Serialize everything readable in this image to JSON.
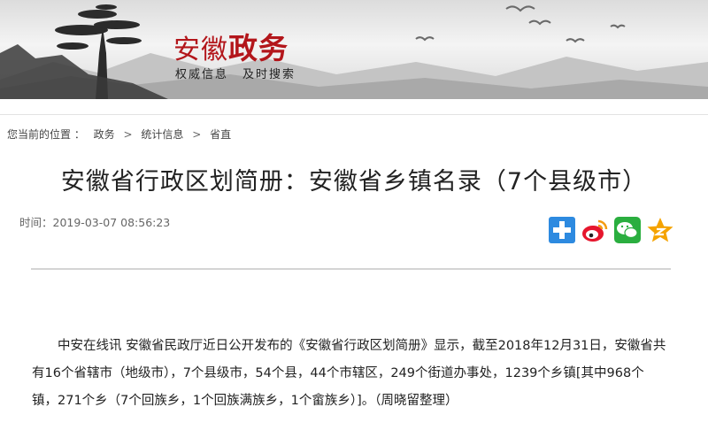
{
  "header": {
    "brand_light": "安徽",
    "brand_bold": "政务",
    "slogan_left": "权威信息",
    "slogan_right": "及时搜索"
  },
  "breadcrumb": {
    "prefix": "您当前的位置 ：",
    "items": [
      "政务",
      "统计信息",
      "省直"
    ],
    "separator": ">"
  },
  "article": {
    "title": "安徽省行政区划简册：安徽省乡镇名录（7个县级市）",
    "meta": "时间：2019-03-07 08:56:23",
    "body": "中安在线讯 安徽省民政厅近日公开发布的《安徽省行政区划简册》显示，截至2018年12月31日，安徽省共有16个省辖市（地级市），7个县级市，54个县，44个市辖区，249个街道办事处，1239个乡镇[其中968个镇，271个乡（7个回族乡，1个回族满族乡，1个畲族乡）]。（周晓留整理）"
  },
  "share": [
    {
      "icon": "plus-share-icon",
      "color": "#2d8ae0"
    },
    {
      "icon": "weibo-icon",
      "color": "#e6162d"
    },
    {
      "icon": "wechat-icon",
      "color": "#2aae3f"
    },
    {
      "icon": "qzone-star-icon",
      "color": "#f5a300"
    }
  ],
  "colors": {
    "brand_red": "#b3161b"
  }
}
